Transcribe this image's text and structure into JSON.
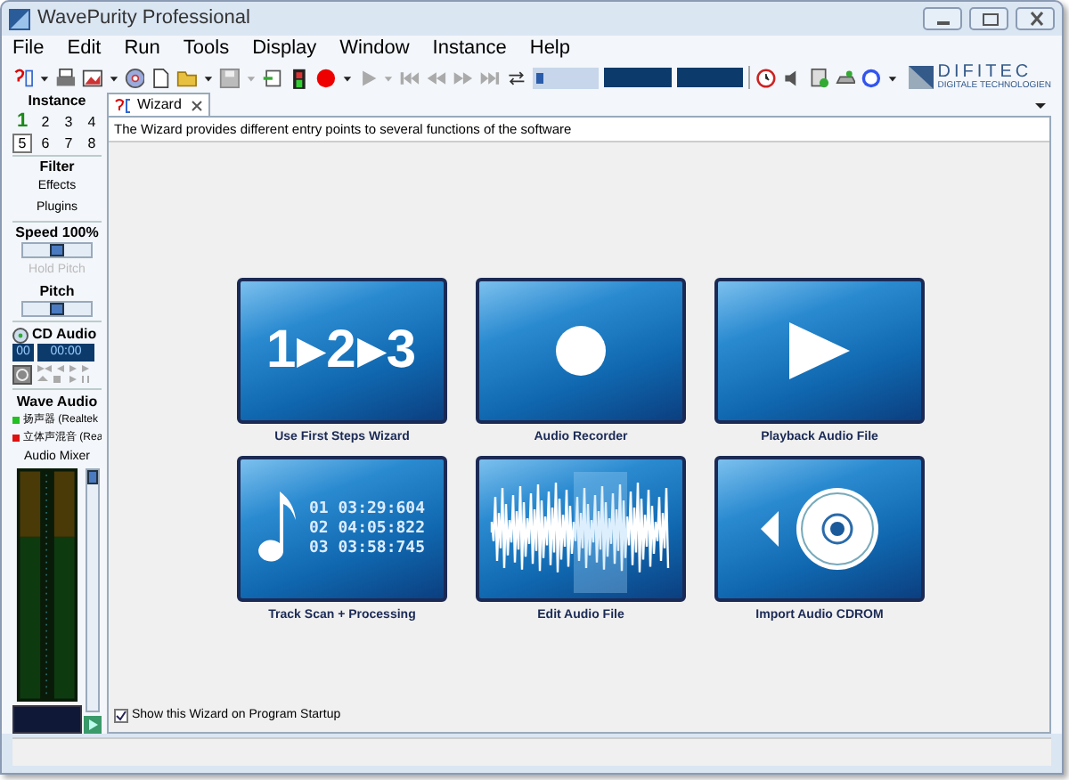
{
  "window": {
    "title": "WavePurity Professional"
  },
  "menu": [
    "File",
    "Edit",
    "Run",
    "Tools",
    "Display",
    "Window",
    "Instance",
    "Help"
  ],
  "position": {
    "level": 0.05
  },
  "logo": {
    "name": "DIFITEC",
    "tagline": "DIGITALE TECHNOLOGIEN"
  },
  "sidebar": {
    "instance_title": "Instance",
    "instances": [
      {
        "label": "1",
        "running": true,
        "selected": false
      },
      {
        "label": "2",
        "running": false,
        "selected": false
      },
      {
        "label": "3",
        "running": false,
        "selected": false
      },
      {
        "label": "4",
        "running": false,
        "selected": false
      },
      {
        "label": "5",
        "running": false,
        "selected": true
      },
      {
        "label": "6",
        "running": false,
        "selected": false
      },
      {
        "label": "7",
        "running": false,
        "selected": false
      },
      {
        "label": "8",
        "running": false,
        "selected": false
      }
    ],
    "filter_title": "Filter",
    "filter_items": [
      "Effects",
      "Plugins"
    ],
    "speed": {
      "label": "Speed 100%",
      "level": 0.5
    },
    "hold_pitch": {
      "label": "Hold Pitch",
      "disabled": true
    },
    "pitch": {
      "label": "Pitch",
      "level": 0.5
    },
    "cd": {
      "title": "CD Audio",
      "track": "00",
      "time": "00:00"
    },
    "wave": {
      "title": "Wave Audio",
      "devices": [
        {
          "label": "扬声器 (Realtek",
          "color": "#22c022"
        },
        {
          "label": "立体声混音 (Rea",
          "color": "#e01010"
        }
      ]
    },
    "mixer": {
      "label": "Audio Mixer",
      "level": 1
    }
  },
  "tabs": [
    {
      "label": "Wizard",
      "selected": true
    }
  ],
  "description": "The Wizard provides different entry points to several functions of the software",
  "tiles": [
    {
      "kind": "steps",
      "label": "Use First Steps Wizard",
      "art_text": "1▸2▸3"
    },
    {
      "kind": "record",
      "label": "Audio Recorder"
    },
    {
      "kind": "play",
      "label": "Playback Audio File"
    },
    {
      "kind": "tracks",
      "label": "Track Scan + Processing",
      "lines": [
        "01 03:29:604",
        "02 04:05:822",
        "03 03:58:745"
      ]
    },
    {
      "kind": "wave",
      "label": "Edit Audio File"
    },
    {
      "kind": "cdrom",
      "label": "Import Audio CDROM"
    }
  ],
  "startup_checkbox": {
    "label": "Show this Wizard on Program Startup",
    "checked": true
  }
}
